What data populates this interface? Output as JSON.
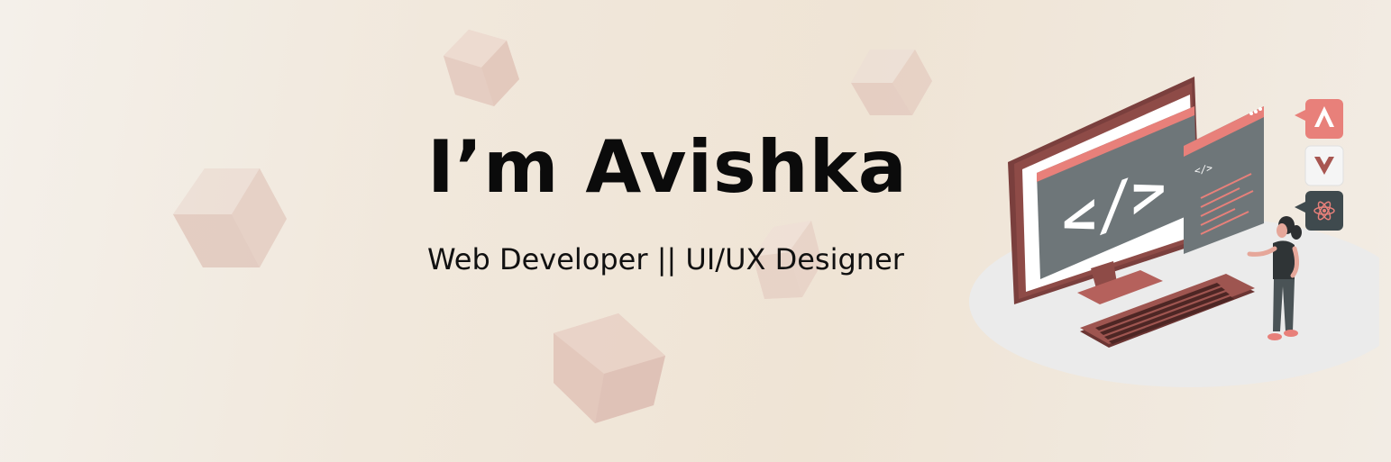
{
  "hero": {
    "title": "I’m Avishka",
    "subtitle": "Web Developer || UI/UX Designer"
  },
  "illustration": {
    "monitor_code_glyph": "</>",
    "editor_tag_glyph": "</>",
    "icons": [
      "angular-icon",
      "vue-icon",
      "react-icon"
    ]
  },
  "colors": {
    "background_start": "#f4f0ea",
    "background_mid": "#efe4d5",
    "cube_light": "#ead5cc",
    "cube_mid": "#e2c4b9",
    "cube_dark": "#dbb8ad",
    "accent_salmon": "#e8807a",
    "accent_maroon": "#8c4e4a",
    "screen_gray": "#6e7679",
    "text": "#0b0b0b"
  }
}
